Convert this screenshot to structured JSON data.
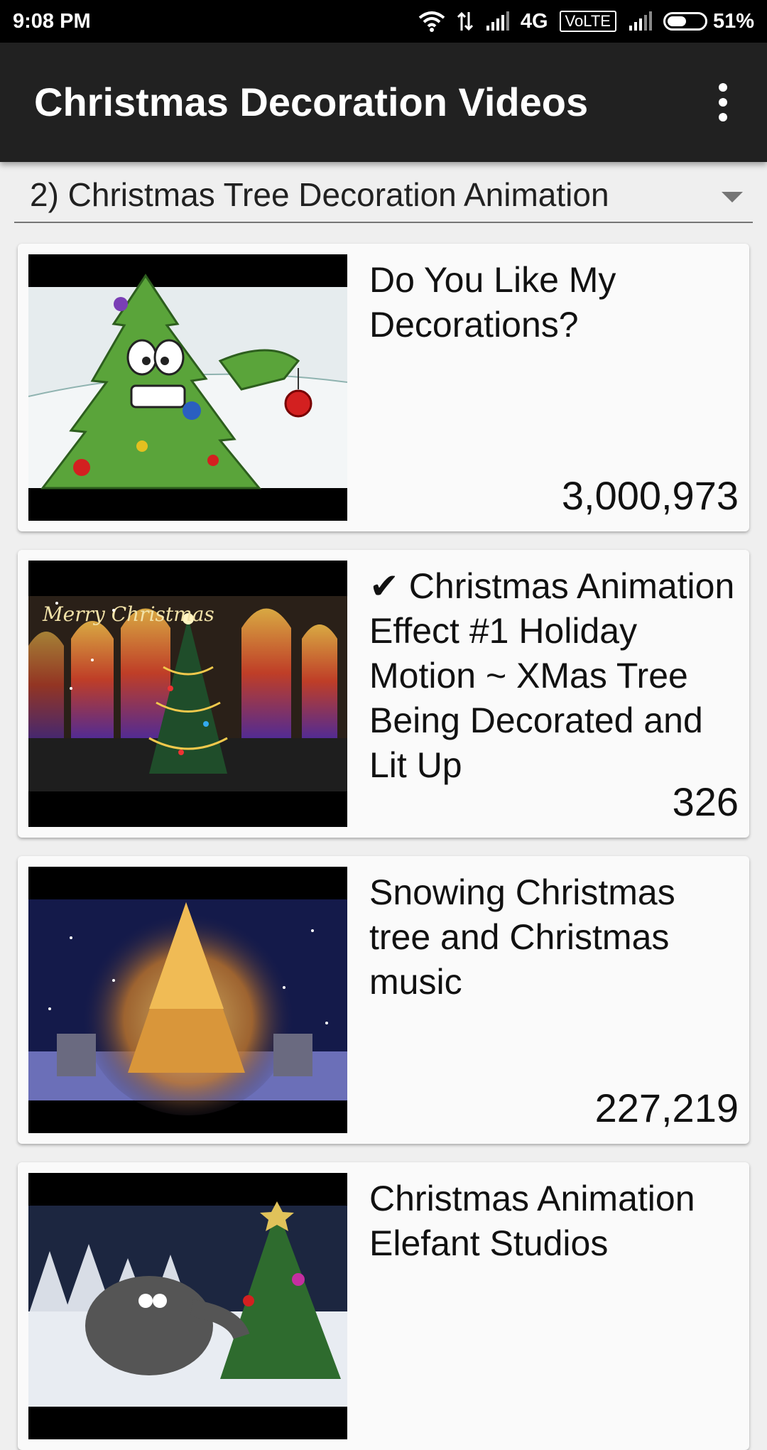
{
  "status_bar": {
    "time": "9:08 PM",
    "network": "4G",
    "volte": "VoLTE",
    "battery_percent": "51%",
    "battery_level": 0.51,
    "icons": [
      "wifi-icon",
      "data-arrows-icon",
      "signal-icon",
      "signal-icon",
      "battery-icon"
    ]
  },
  "app_bar": {
    "title": "Christmas Decoration Videos",
    "menu_icon": "overflow-menu-icon"
  },
  "playlist_spinner": {
    "selected": "2) Christmas Tree Decoration Animation"
  },
  "videos": [
    {
      "title": "Do You Like My Decorations?",
      "views": "3,000,973",
      "thumbnail_text": ""
    },
    {
      "title": "✔ Christmas Animation Effect #1 Holiday Motion  ~ XMas Tree Being Decorated and Lit Up",
      "views": "326",
      "thumbnail_text": "Merry Christmas"
    },
    {
      "title": "Snowing Christmas tree and Christmas music",
      "views": "227,219",
      "thumbnail_text": ""
    },
    {
      "title": "Christmas Animation Elefant Studios",
      "views": "",
      "thumbnail_text": ""
    }
  ],
  "colors": {
    "status_bar": "#000000",
    "app_bar": "#212121",
    "background": "#efefef",
    "card": "#fafafa"
  }
}
